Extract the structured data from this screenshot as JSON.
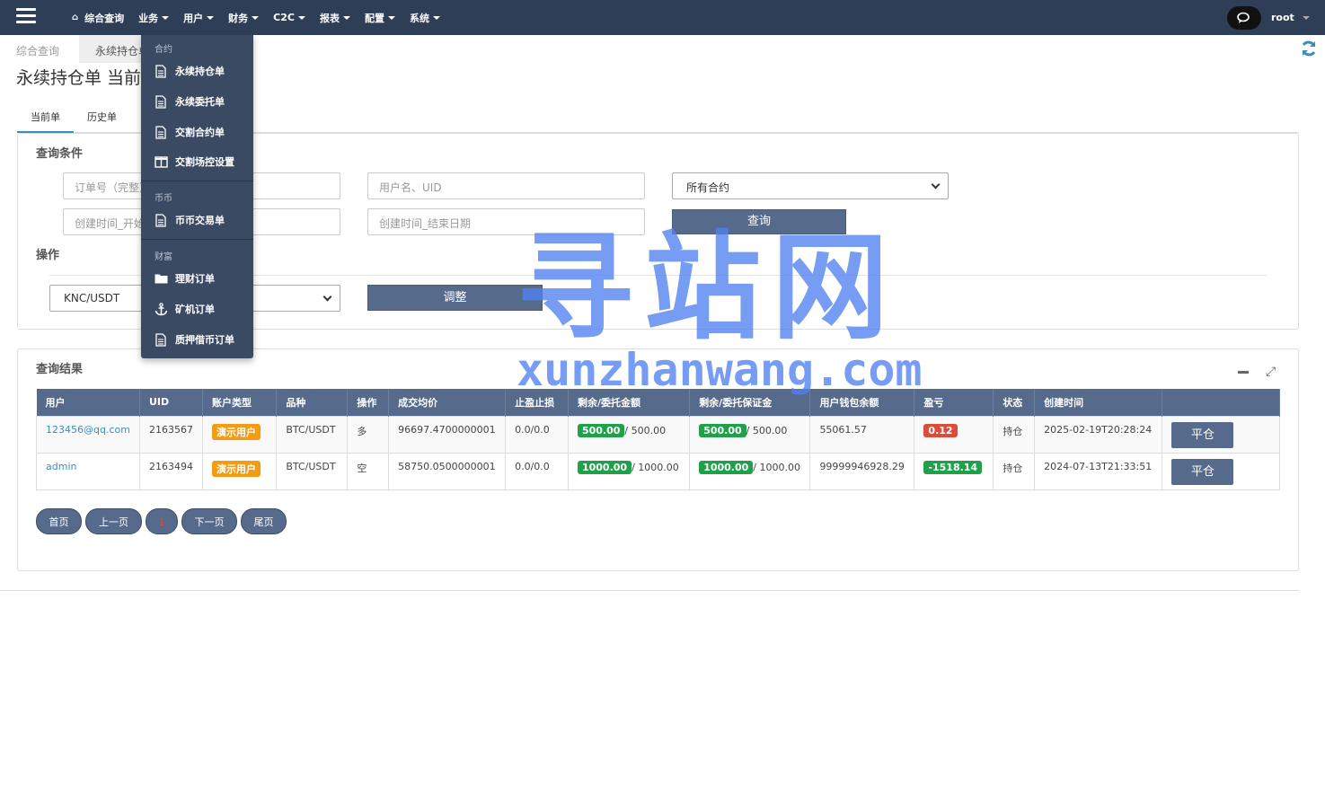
{
  "topnav": {
    "home_label": "综合查询",
    "items": [
      "业务",
      "用户",
      "财务",
      "C2C",
      "报表",
      "配置",
      "系统"
    ],
    "user": "root"
  },
  "breadcrumb": {
    "crumb1": "综合查询",
    "crumb2": "永续持仓单"
  },
  "page_title": "永续持仓单 当前单",
  "tabs": [
    "当前单",
    "历史单"
  ],
  "query": {
    "title": "查询条件",
    "order_placeholder": "订单号（完整）",
    "user_placeholder": "用户名、UID",
    "contract_select": "所有合约",
    "start_placeholder": "创建时间_开始日期",
    "end_placeholder": "创建时间_结束日期",
    "search_label": "查询",
    "ops_title": "操作",
    "pair_select": "KNC/USDT",
    "adjust_label": "调整"
  },
  "results": {
    "title": "查询结果",
    "columns": [
      "用户",
      "UID",
      "账户类型",
      "品种",
      "操作",
      "成交均价",
      "止盈止损",
      "剩余/委托金额",
      "剩余/委托保证金",
      "用户钱包余额",
      "盈亏",
      "状态",
      "创建时间",
      ""
    ],
    "rows": [
      {
        "user": "123456@qq.com",
        "uid": "2163567",
        "acct": "演示用户",
        "symbol": "BTC/USDT",
        "side": "多",
        "avg": "96697.4700000001",
        "tpsl": "0.0/0.0",
        "amt_rem": "500.00",
        "amt_tot": "/ 500.00",
        "mg_rem": "500.00",
        "mg_tot": "/ 500.00",
        "wallet": "55061.57",
        "pnl": "0.12",
        "pnl_color": "#dd4b39",
        "status": "持仓",
        "created": "2025-02-19T20:28:24",
        "action": "平仓"
      },
      {
        "user": "admin",
        "uid": "2163494",
        "acct": "演示用户",
        "symbol": "BTC/USDT",
        "side": "空",
        "avg": "58750.0500000001",
        "tpsl": "0.0/0.0",
        "amt_rem": "1000.00",
        "amt_tot": "/ 1000.00",
        "mg_rem": "1000.00",
        "mg_tot": "/ 1000.00",
        "wallet": "99999946928.29",
        "pnl": "-1518.14",
        "pnl_color": "#1fa14a",
        "status": "持仓",
        "created": "2024-07-13T21:33:51",
        "action": "平仓"
      }
    ]
  },
  "pager": {
    "first": "首页",
    "prev": "上一页",
    "current": "1",
    "next": "下一页",
    "last": "尾页"
  },
  "dropdown": {
    "section1": "合约",
    "items1": [
      "永续持仓单",
      "永续委托单",
      "交割合约单",
      "交割场控设置"
    ],
    "section2": "币币",
    "items2": [
      "币币交易单"
    ],
    "section3": "财富",
    "items3": [
      "理财订单",
      "矿机订单",
      "质押借币订单"
    ]
  },
  "watermark": {
    "big": "寻站网",
    "small": "xunzhanwang.com"
  }
}
